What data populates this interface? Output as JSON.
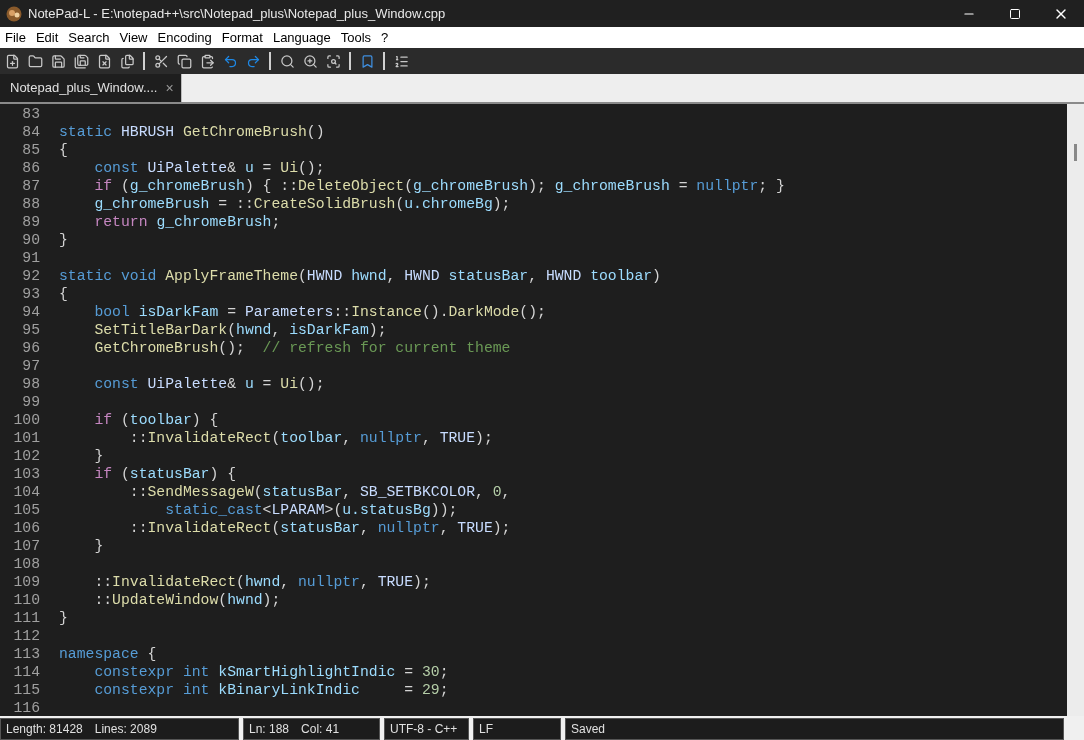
{
  "window": {
    "title": "NotePad-L - E:\\notepad++\\src\\Notepad_plus\\Notepad_plus_Window.cpp"
  },
  "menu": [
    "File",
    "Edit",
    "Search",
    "View",
    "Encoding",
    "Format",
    "Language",
    "Tools",
    "?"
  ],
  "tabs": [
    {
      "label": "Notepad_plus_Window....",
      "selected": true,
      "close": "×"
    }
  ],
  "editor": {
    "lines": [
      {
        "num": "83"
      },
      {
        "num": "84",
        "tokens": [
          {
            "kind": "kw",
            "text": "static "
          },
          {
            "kind": "type",
            "text": "HBRUSH "
          },
          {
            "kind": "fn",
            "text": "GetChromeBrush"
          },
          {
            "kind": "p",
            "text": "()"
          }
        ]
      },
      {
        "num": "85",
        "tokens": [
          {
            "kind": "p",
            "text": "{"
          }
        ]
      },
      {
        "num": "86",
        "tokens": [
          {
            "kind": "kw",
            "text": "    const "
          },
          {
            "kind": "type",
            "text": "UiPalette"
          },
          {
            "kind": "p",
            "text": "& "
          },
          {
            "kind": "var",
            "text": "u"
          },
          {
            "kind": "p",
            "text": " = "
          },
          {
            "kind": "fn",
            "text": "Ui"
          },
          {
            "kind": "p",
            "text": "();"
          }
        ]
      },
      {
        "num": "87",
        "tokens": [
          {
            "kind": "ctrl",
            "text": "    if"
          },
          {
            "kind": "p",
            "text": " ("
          },
          {
            "kind": "var",
            "text": "g_chromeBrush"
          },
          {
            "kind": "p",
            "text": ") { ::"
          },
          {
            "kind": "fn",
            "text": "DeleteObject"
          },
          {
            "kind": "p",
            "text": "("
          },
          {
            "kind": "var",
            "text": "g_chromeBrush"
          },
          {
            "kind": "p",
            "text": "); "
          },
          {
            "kind": "var",
            "text": "g_chromeBrush"
          },
          {
            "kind": "p",
            "text": " = "
          },
          {
            "kind": "kw",
            "text": "nullptr"
          },
          {
            "kind": "p",
            "text": "; }"
          }
        ]
      },
      {
        "num": "88",
        "tokens": [
          {
            "kind": "var",
            "text": "    g_chromeBrush"
          },
          {
            "kind": "p",
            "text": " = ::"
          },
          {
            "kind": "fn",
            "text": "CreateSolidBrush"
          },
          {
            "kind": "p",
            "text": "("
          },
          {
            "kind": "var",
            "text": "u.chromeBg"
          },
          {
            "kind": "p",
            "text": ");"
          }
        ]
      },
      {
        "num": "89",
        "tokens": [
          {
            "kind": "ctrl",
            "text": "    return "
          },
          {
            "kind": "var",
            "text": "g_chromeBrush"
          },
          {
            "kind": "p",
            "text": ";"
          }
        ]
      },
      {
        "num": "90",
        "tokens": [
          {
            "kind": "p",
            "text": "}"
          }
        ]
      },
      {
        "num": "91"
      },
      {
        "num": "92",
        "tokens": [
          {
            "kind": "kw",
            "text": "static void "
          },
          {
            "kind": "fn",
            "text": "ApplyFrameTheme"
          },
          {
            "kind": "p",
            "text": "("
          },
          {
            "kind": "type",
            "text": "HWND "
          },
          {
            "kind": "var",
            "text": "hwnd"
          },
          {
            "kind": "p",
            "text": ", "
          },
          {
            "kind": "type",
            "text": "HWND "
          },
          {
            "kind": "var",
            "text": "statusBar"
          },
          {
            "kind": "p",
            "text": ", "
          },
          {
            "kind": "type",
            "text": "HWND "
          },
          {
            "kind": "var",
            "text": "toolbar"
          },
          {
            "kind": "p",
            "text": ")"
          }
        ]
      },
      {
        "num": "93",
        "tokens": [
          {
            "kind": "p",
            "text": "{"
          }
        ]
      },
      {
        "num": "94",
        "tokens": [
          {
            "kind": "kw",
            "text": "    bool "
          },
          {
            "kind": "var",
            "text": "isDarkFam"
          },
          {
            "kind": "p",
            "text": " = "
          },
          {
            "kind": "type",
            "text": "Parameters"
          },
          {
            "kind": "p",
            "text": "::"
          },
          {
            "kind": "fn",
            "text": "Instance"
          },
          {
            "kind": "p",
            "text": "()."
          },
          {
            "kind": "fn",
            "text": "DarkMode"
          },
          {
            "kind": "p",
            "text": "();"
          }
        ]
      },
      {
        "num": "95",
        "tokens": [
          {
            "kind": "fn",
            "text": "    SetTitleBarDark"
          },
          {
            "kind": "p",
            "text": "("
          },
          {
            "kind": "var",
            "text": "hwnd"
          },
          {
            "kind": "p",
            "text": ", "
          },
          {
            "kind": "var",
            "text": "isDarkFam"
          },
          {
            "kind": "p",
            "text": ");"
          }
        ]
      },
      {
        "num": "96",
        "tokens": [
          {
            "kind": "fn",
            "text": "    GetChromeBrush"
          },
          {
            "kind": "p",
            "text": "();  "
          },
          {
            "kind": "cmt",
            "text": "// refresh for current theme"
          }
        ]
      },
      {
        "num": "97"
      },
      {
        "num": "98",
        "tokens": [
          {
            "kind": "kw",
            "text": "    const "
          },
          {
            "kind": "type",
            "text": "UiPalette"
          },
          {
            "kind": "p",
            "text": "& "
          },
          {
            "kind": "var",
            "text": "u"
          },
          {
            "kind": "p",
            "text": " = "
          },
          {
            "kind": "fn",
            "text": "Ui"
          },
          {
            "kind": "p",
            "text": "();"
          }
        ]
      },
      {
        "num": "99"
      },
      {
        "num": "100",
        "tokens": [
          {
            "kind": "ctrl",
            "text": "    if"
          },
          {
            "kind": "p",
            "text": " ("
          },
          {
            "kind": "var",
            "text": "toolbar"
          },
          {
            "kind": "p",
            "text": ") {"
          }
        ]
      },
      {
        "num": "101",
        "tokens": [
          {
            "kind": "p",
            "text": "        ::"
          },
          {
            "kind": "fn",
            "text": "InvalidateRect"
          },
          {
            "kind": "p",
            "text": "("
          },
          {
            "kind": "var",
            "text": "toolbar"
          },
          {
            "kind": "p",
            "text": ", "
          },
          {
            "kind": "kw",
            "text": "nullptr"
          },
          {
            "kind": "p",
            "text": ", "
          },
          {
            "kind": "type",
            "text": "TRUE"
          },
          {
            "kind": "p",
            "text": ");"
          }
        ]
      },
      {
        "num": "102",
        "tokens": [
          {
            "kind": "p",
            "text": "    }"
          }
        ]
      },
      {
        "num": "103",
        "tokens": [
          {
            "kind": "ctrl",
            "text": "    if"
          },
          {
            "kind": "p",
            "text": " ("
          },
          {
            "kind": "var",
            "text": "statusBar"
          },
          {
            "kind": "p",
            "text": ") {"
          }
        ]
      },
      {
        "num": "104",
        "tokens": [
          {
            "kind": "p",
            "text": "        ::"
          },
          {
            "kind": "fn",
            "text": "SendMessageW"
          },
          {
            "kind": "p",
            "text": "("
          },
          {
            "kind": "var",
            "text": "statusBar"
          },
          {
            "kind": "p",
            "text": ", "
          },
          {
            "kind": "type",
            "text": "SB_SETBKCOLOR"
          },
          {
            "kind": "p",
            "text": ", "
          },
          {
            "kind": "num",
            "text": "0"
          },
          {
            "kind": "p",
            "text": ","
          }
        ]
      },
      {
        "num": "105",
        "tokens": [
          {
            "kind": "kw",
            "text": "            static_cast"
          },
          {
            "kind": "p",
            "text": "<"
          },
          {
            "kind": "type",
            "text": "LPARAM"
          },
          {
            "kind": "p",
            "text": ">("
          },
          {
            "kind": "var",
            "text": "u.statusBg"
          },
          {
            "kind": "p",
            "text": "));"
          }
        ]
      },
      {
        "num": "106",
        "tokens": [
          {
            "kind": "p",
            "text": "        ::"
          },
          {
            "kind": "fn",
            "text": "InvalidateRect"
          },
          {
            "kind": "p",
            "text": "("
          },
          {
            "kind": "var",
            "text": "statusBar"
          },
          {
            "kind": "p",
            "text": ", "
          },
          {
            "kind": "kw",
            "text": "nullptr"
          },
          {
            "kind": "p",
            "text": ", "
          },
          {
            "kind": "type",
            "text": "TRUE"
          },
          {
            "kind": "p",
            "text": ");"
          }
        ]
      },
      {
        "num": "107",
        "tokens": [
          {
            "kind": "p",
            "text": "    }"
          }
        ]
      },
      {
        "num": "108"
      },
      {
        "num": "109",
        "tokens": [
          {
            "kind": "p",
            "text": "    ::"
          },
          {
            "kind": "fn",
            "text": "InvalidateRect"
          },
          {
            "kind": "p",
            "text": "("
          },
          {
            "kind": "var",
            "text": "hwnd"
          },
          {
            "kind": "p",
            "text": ", "
          },
          {
            "kind": "kw",
            "text": "nullptr"
          },
          {
            "kind": "p",
            "text": ", "
          },
          {
            "kind": "type",
            "text": "TRUE"
          },
          {
            "kind": "p",
            "text": ");"
          }
        ]
      },
      {
        "num": "110",
        "tokens": [
          {
            "kind": "p",
            "text": "    ::"
          },
          {
            "kind": "fn",
            "text": "UpdateWindow"
          },
          {
            "kind": "p",
            "text": "("
          },
          {
            "kind": "var",
            "text": "hwnd"
          },
          {
            "kind": "p",
            "text": ");"
          }
        ]
      },
      {
        "num": "111",
        "tokens": [
          {
            "kind": "p",
            "text": "}"
          }
        ]
      },
      {
        "num": "112"
      },
      {
        "num": "113",
        "tokens": [
          {
            "kind": "kw",
            "text": "namespace "
          },
          {
            "kind": "p",
            "text": "{"
          }
        ]
      },
      {
        "num": "114",
        "tokens": [
          {
            "kind": "kw",
            "text": "    constexpr int "
          },
          {
            "kind": "var",
            "text": "kSmartHighlightIndic"
          },
          {
            "kind": "p",
            "text": " = "
          },
          {
            "kind": "num",
            "text": "30"
          },
          {
            "kind": "p",
            "text": ";"
          }
        ]
      },
      {
        "num": "115",
        "tokens": [
          {
            "kind": "kw",
            "text": "    constexpr int "
          },
          {
            "kind": "var",
            "text": "kBinaryLinkIndic"
          },
          {
            "kind": "p",
            "text": "     = "
          },
          {
            "kind": "num",
            "text": "29"
          },
          {
            "kind": "p",
            "text": ";"
          }
        ]
      },
      {
        "num": "116"
      }
    ]
  },
  "status_bar": [
    [
      "Length: 81428",
      "Lines: 2089"
    ],
    [
      "Ln: 188",
      "Col: 41"
    ],
    [
      "UTF-8 - C++"
    ],
    [
      "LF"
    ],
    [
      "Saved"
    ]
  ]
}
